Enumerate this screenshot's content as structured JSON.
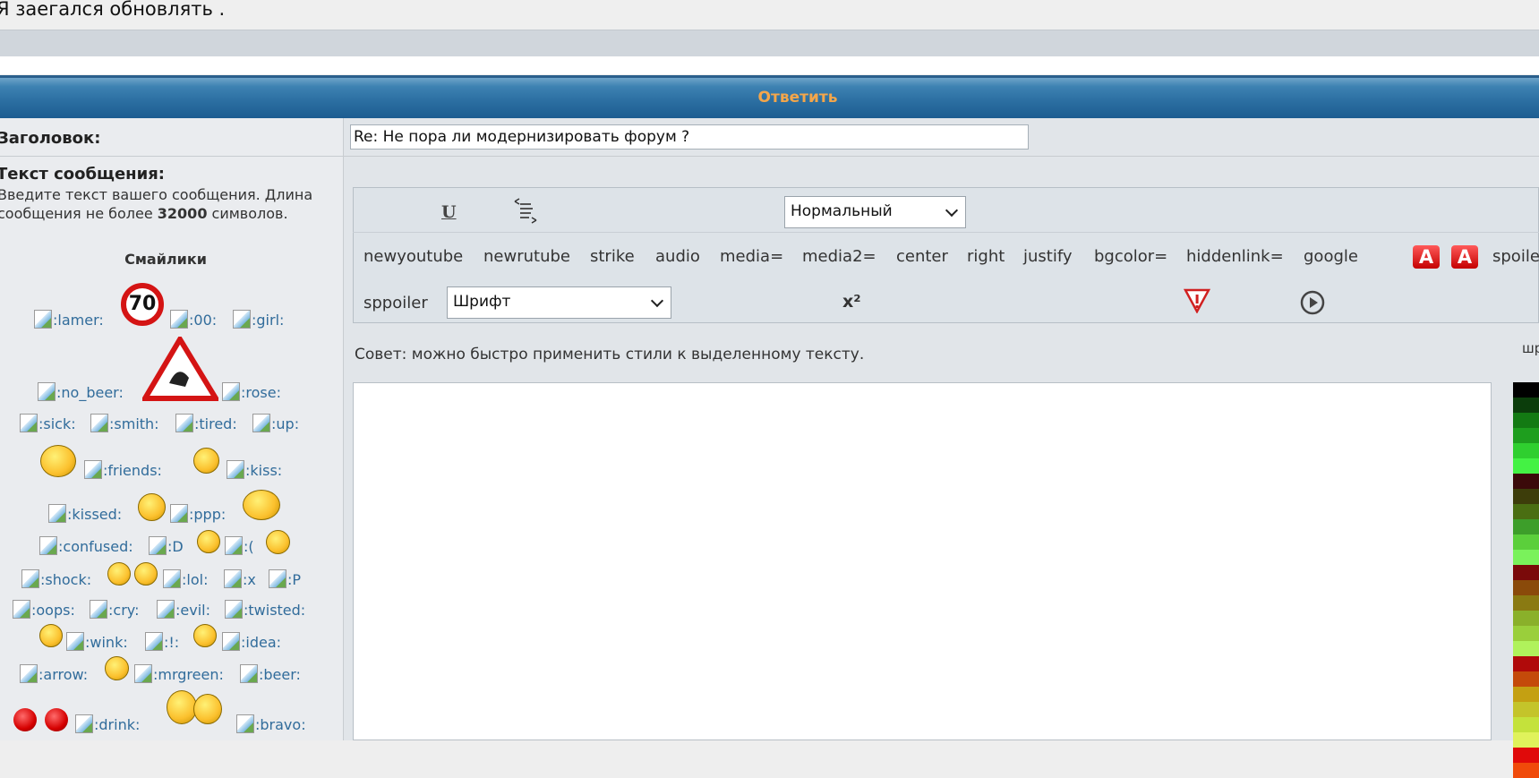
{
  "quote": {
    "text": "Я заегался обновлять ."
  },
  "reply_header": {
    "title": "Ответить"
  },
  "title_field": {
    "label": "Заголовок:",
    "value": "Re: Не пора ли модернизировать форум ?"
  },
  "message_field": {
    "label": "Текст сообщения:",
    "help_prefix": "Введите текст вашего сообщения. Длина сообщения не более ",
    "help_limit": "32000",
    "help_suffix": " символов."
  },
  "smilies": {
    "title": "Смайлики",
    "codes": [
      ":lamer:",
      ":00:",
      ":girl:",
      ":no_beer:",
      ":rose:",
      ":sick:",
      ":smith:",
      ":tired:",
      ":up:",
      ":friends:",
      ":kiss:",
      ":kissed:",
      ":ppp:",
      ":confused:",
      ":D",
      ":(",
      ":shock:",
      ":lol:",
      ":x",
      ":P",
      ":oops:",
      ":cry:",
      ":evil:",
      ":twisted:",
      ":wink:",
      ":!:",
      ":idea:",
      ":arrow:",
      ":mrgreen:",
      ":beer:",
      ":drink:",
      ":bravo:"
    ],
    "sign_70": "70"
  },
  "toolbar": {
    "size_select": "Нормальный",
    "font_select": "Шрифт",
    "buttons": [
      "newyoutube",
      "newrutube",
      "strike",
      "audio",
      "media=",
      "media2=",
      "center",
      "right",
      "justify",
      "bgcolor=",
      "hiddenlink=",
      "google",
      "spoile"
    ],
    "sppoiler": "sppoiler",
    "underline_label": "U",
    "sup_label": "x²"
  },
  "advice": "Совет: можно быстро применить стили к выделенному тексту.",
  "palette": {
    "label": "шр",
    "colors": [
      "#000000",
      "#0b3d0b",
      "#137a13",
      "#1e9e1e",
      "#2fcf2f",
      "#44f244",
      "#3b0a0a",
      "#3d3d0a",
      "#4a6e12",
      "#3d9e2a",
      "#5bcf3b",
      "#7af25b",
      "#7a0a0a",
      "#8a4a0a",
      "#8a7a12",
      "#8ab02a",
      "#9acf3b",
      "#b0f25b",
      "#b00a0a",
      "#c44a0a",
      "#c4a012",
      "#c4c42a",
      "#c4e23b",
      "#e0f25b",
      "#e00a0a",
      "#f04a0a"
    ]
  }
}
